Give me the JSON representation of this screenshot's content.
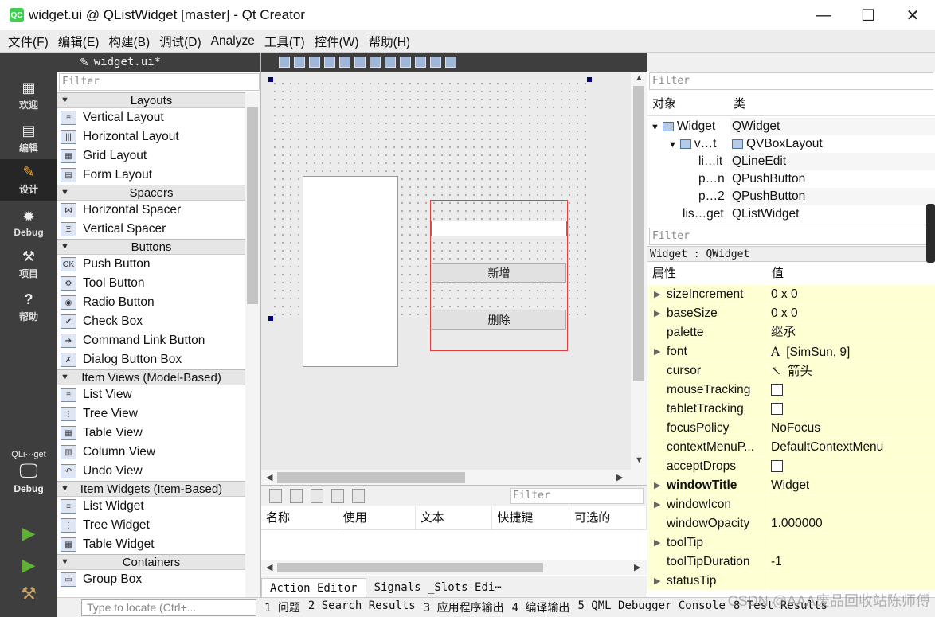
{
  "window": {
    "title": "widget.ui @ QListWidget [master] - Qt Creator",
    "logo": "QC",
    "controls": {
      "minimize": "—",
      "maximize": "☐",
      "close": "✕"
    }
  },
  "menu": [
    "文件(F)",
    "编辑(E)",
    "构建(B)",
    "调试(D)",
    "Analyze",
    "工具(T)",
    "控件(W)",
    "帮助(H)"
  ],
  "modes": [
    {
      "label": "欢迎",
      "icon": "grid-icon"
    },
    {
      "label": "编辑",
      "icon": "document-icon"
    },
    {
      "label": "设计",
      "icon": "pencil-icon",
      "active": true
    },
    {
      "label": "Debug",
      "icon": "bug-icon"
    },
    {
      "label": "项目",
      "icon": "wrench-icon"
    },
    {
      "label": "帮助",
      "icon": "help-icon"
    }
  ],
  "kit": {
    "project": "QLi⋯get",
    "mode": "Debug"
  },
  "editor_tab": {
    "file": "widget.ui*"
  },
  "widget_box": {
    "filter_placeholder": "Filter",
    "categories": [
      {
        "name": "Layouts",
        "items": [
          "Vertical Layout",
          "Horizontal Layout",
          "Grid Layout",
          "Form Layout"
        ]
      },
      {
        "name": "Spacers",
        "items": [
          "Horizontal Spacer",
          "Vertical Spacer"
        ]
      },
      {
        "name": "Buttons",
        "items": [
          "Push Button",
          "Tool Button",
          "Radio Button",
          "Check Box",
          "Command Link Button",
          "Dialog Button Box"
        ]
      },
      {
        "name": "Item Views (Model-Based)",
        "items": [
          "List View",
          "Tree View",
          "Table View",
          "Column View",
          "Undo View"
        ]
      },
      {
        "name": "Item Widgets (Item-Based)",
        "items": [
          "List Widget",
          "Tree Widget",
          "Table Widget"
        ]
      },
      {
        "name": "Containers",
        "items": [
          "Group Box"
        ]
      }
    ]
  },
  "form": {
    "buttons": [
      "新增",
      "删除"
    ]
  },
  "action_editor": {
    "filter_placeholder": "Filter",
    "columns": [
      "名称",
      "使用",
      "文本",
      "快捷键",
      "可选的"
    ],
    "tabs": [
      "Action Editor",
      "Signals _Slots Edi⋯"
    ]
  },
  "object_inspector": {
    "filter_placeholder": "Filter",
    "columns": [
      "对象",
      "类"
    ],
    "rows": [
      {
        "name": "Widget",
        "class": "QWidget"
      },
      {
        "name": "v…t",
        "class": "QVBoxLayout"
      },
      {
        "name": "li…it",
        "class": "QLineEdit"
      },
      {
        "name": "p…n",
        "class": "QPushButton"
      },
      {
        "name": "p…2",
        "class": "QPushButton"
      },
      {
        "name": "lis…get",
        "class": "QListWidget"
      }
    ]
  },
  "property_editor": {
    "filter_placeholder": "Filter",
    "title": "Widget : QWidget",
    "columns": [
      "属性",
      "值"
    ],
    "rows": [
      {
        "name": "sizeIncrement",
        "value": "0 x 0",
        "expandable": true
      },
      {
        "name": "baseSize",
        "value": "0 x 0",
        "expandable": true
      },
      {
        "name": "palette",
        "value": "继承"
      },
      {
        "name": "font",
        "value": "[SimSun, 9]",
        "expandable": true,
        "prefix": "A"
      },
      {
        "name": "cursor",
        "value": "箭头",
        "prefix": "↖"
      },
      {
        "name": "mouseTracking",
        "value": "",
        "checkbox": true
      },
      {
        "name": "tabletTracking",
        "value": "",
        "checkbox": true
      },
      {
        "name": "focusPolicy",
        "value": "NoFocus"
      },
      {
        "name": "contextMenuP...",
        "value": "DefaultContextMenu"
      },
      {
        "name": "acceptDrops",
        "value": "",
        "checkbox": true
      },
      {
        "name": "windowTitle",
        "value": "Widget",
        "expandable": true,
        "bold": true
      },
      {
        "name": "windowIcon",
        "value": "",
        "expandable": true
      },
      {
        "name": "windowOpacity",
        "value": "1.000000"
      },
      {
        "name": "toolTip",
        "value": "",
        "expandable": true
      },
      {
        "name": "toolTipDuration",
        "value": "-1"
      },
      {
        "name": "statusTip",
        "value": "",
        "expandable": true
      }
    ]
  },
  "statusbar": {
    "locate_placeholder": "Type to locate (Ctrl+...",
    "tabs": [
      "1 问题",
      "2 Search Results",
      "3 应用程序输出",
      "4 编译输出",
      "5 QML Debugger Console",
      "8 Test Results"
    ]
  },
  "watermark": "CSDN @AAA废品回收站陈师傅"
}
